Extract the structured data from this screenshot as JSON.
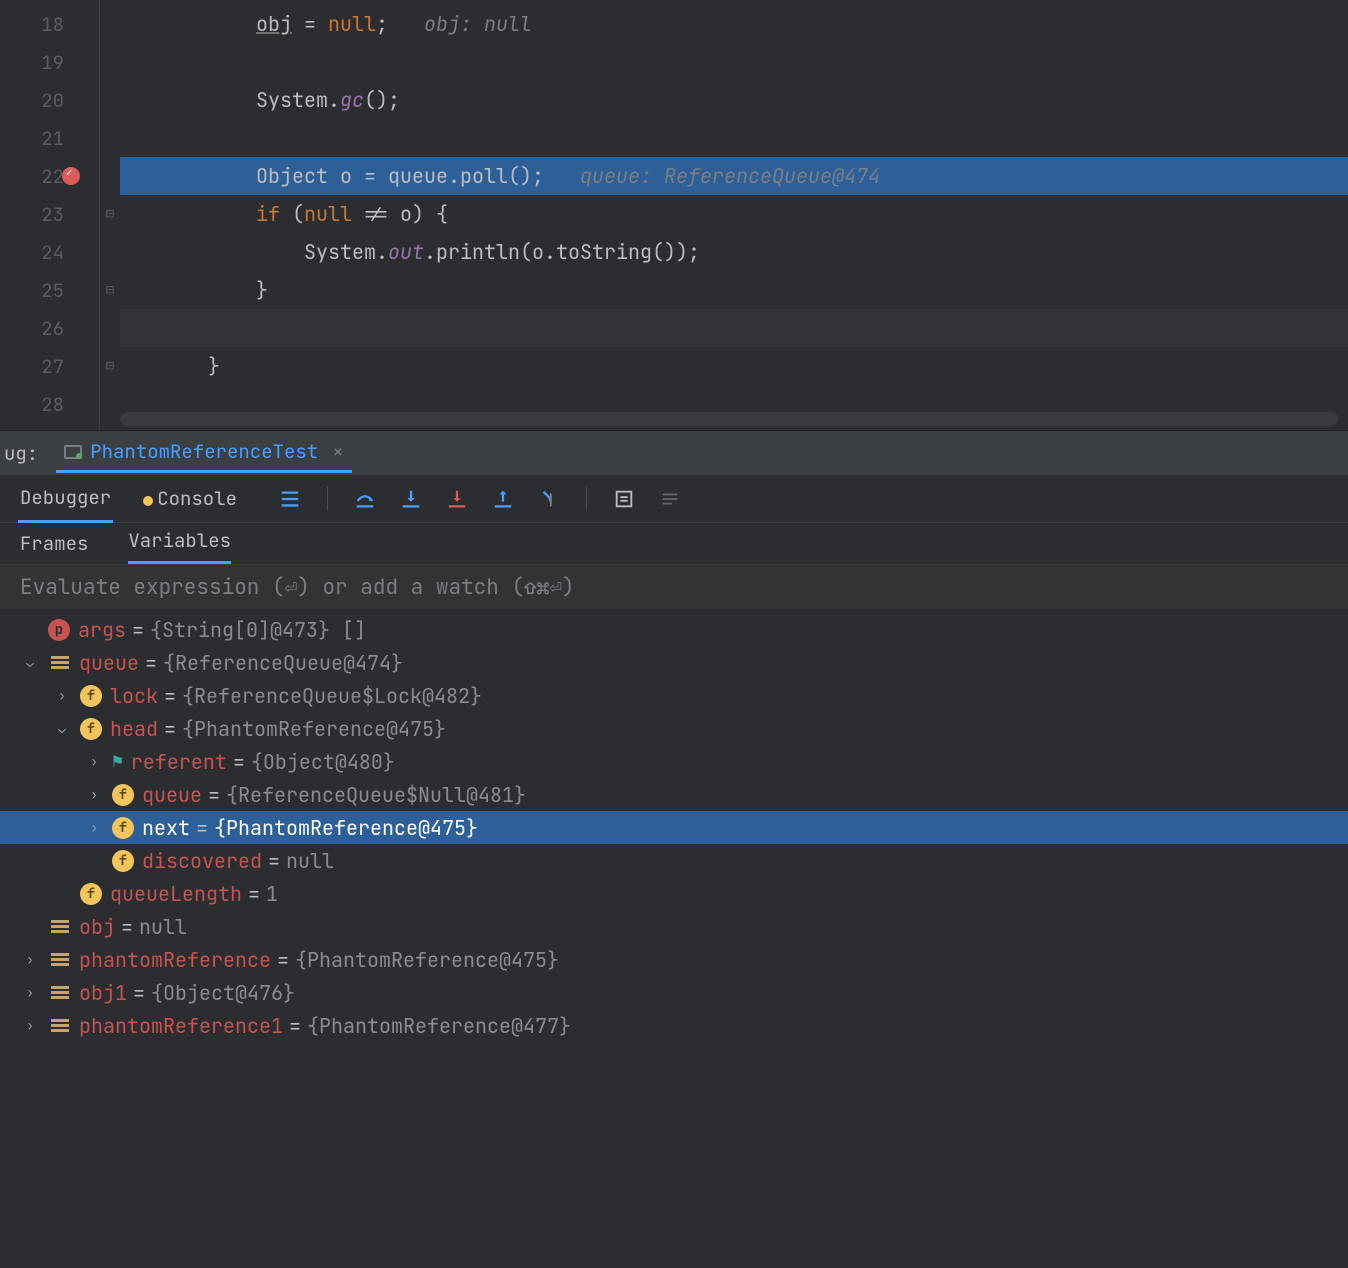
{
  "editor": {
    "lines": [
      {
        "num": 18,
        "tokens": [
          [
            "        ",
            ""
          ],
          [
            "obj",
            "ident underline"
          ],
          [
            " = ",
            ""
          ],
          [
            "null",
            "kw"
          ],
          [
            ";   ",
            ""
          ],
          [
            "obj: null",
            "hint"
          ]
        ]
      },
      {
        "num": 19,
        "tokens": []
      },
      {
        "num": 20,
        "tokens": [
          [
            "        ",
            ""
          ],
          [
            "System.",
            ""
          ],
          [
            "gc",
            "field"
          ],
          [
            "();",
            ""
          ]
        ]
      },
      {
        "num": 21,
        "tokens": []
      },
      {
        "num": 22,
        "hl": true,
        "breakpoint": true,
        "tokens": [
          [
            "        ",
            ""
          ],
          [
            "Object o = queue.poll();   ",
            ""
          ],
          [
            "queue: ReferenceQueue@474",
            "hint"
          ]
        ]
      },
      {
        "num": 23,
        "fold": "⊟",
        "tokens": [
          [
            "        ",
            ""
          ],
          [
            "if ",
            "kw"
          ],
          [
            "(",
            ""
          ],
          [
            "null ",
            "kw"
          ],
          [
            "!= o) {",
            ""
          ]
        ]
      },
      {
        "num": 24,
        "tokens": [
          [
            "            System.",
            ""
          ],
          [
            "out",
            "field"
          ],
          [
            ".println(o.toString());",
            ""
          ]
        ]
      },
      {
        "num": 25,
        "fold": "⊟",
        "tokens": [
          [
            "        }",
            ""
          ]
        ]
      },
      {
        "num": 26,
        "caret": true,
        "tokens": []
      },
      {
        "num": 27,
        "fold": "⊟",
        "tokens": [
          [
            "    }",
            ""
          ]
        ]
      },
      {
        "num": 28,
        "tokens": []
      }
    ]
  },
  "debug": {
    "label": "ug:",
    "runConfig": "PhantomReferenceTest",
    "tabs": {
      "debugger": "Debugger",
      "console": "Console"
    },
    "subTabs": {
      "frames": "Frames",
      "variables": "Variables"
    },
    "watchPlaceholder": "Evaluate expression (⏎) or add a watch (⇧⌘⏎)"
  },
  "variables": [
    {
      "depth": 0,
      "expand": "",
      "icon": "p",
      "name": "args",
      "value": "{String[0]@473} []"
    },
    {
      "depth": 0,
      "expand": "v",
      "icon": "lines",
      "name": "queue",
      "value": "{ReferenceQueue@474}"
    },
    {
      "depth": 1,
      "expand": ">",
      "icon": "f",
      "name": "lock",
      "value": "{ReferenceQueue$Lock@482}"
    },
    {
      "depth": 1,
      "expand": "v",
      "icon": "f",
      "name": "head",
      "value": "{PhantomReference@475}"
    },
    {
      "depth": 2,
      "expand": ">",
      "icon": "flag",
      "name": "referent",
      "value": "{Object@480}"
    },
    {
      "depth": 2,
      "expand": ">",
      "icon": "f",
      "name": "queue",
      "value": "{ReferenceQueue$Null@481}"
    },
    {
      "depth": 2,
      "expand": ">",
      "icon": "f",
      "name": "next",
      "value": "{PhantomReference@475}",
      "sel": true
    },
    {
      "depth": 2,
      "expand": "",
      "icon": "f",
      "name": "discovered",
      "value": "null"
    },
    {
      "depth": 1,
      "expand": "",
      "icon": "f",
      "name": "queueLength",
      "value": "1"
    },
    {
      "depth": 0,
      "expand": "",
      "icon": "lines",
      "name": "obj",
      "value": "null"
    },
    {
      "depth": 0,
      "expand": ">",
      "icon": "lines",
      "name": "phantomReference",
      "value": "{PhantomReference@475}"
    },
    {
      "depth": 0,
      "expand": ">",
      "icon": "lines",
      "name": "obj1",
      "value": "{Object@476}"
    },
    {
      "depth": 0,
      "expand": ">",
      "icon": "lines",
      "name": "phantomReference1",
      "value": "{PhantomReference@477}"
    }
  ]
}
